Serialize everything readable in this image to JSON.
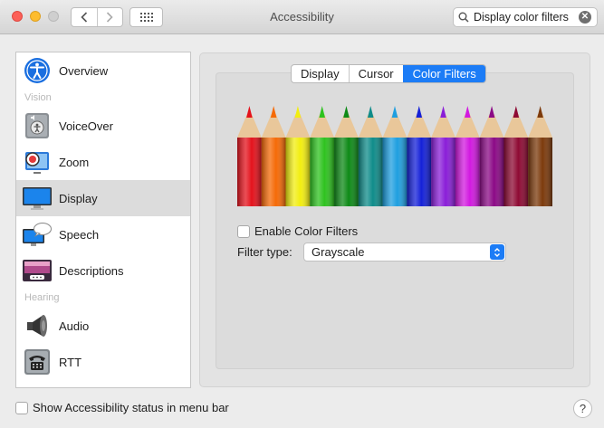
{
  "window": {
    "title": "Accessibility"
  },
  "search": {
    "value": "Display color filters"
  },
  "sidebar": {
    "items": [
      {
        "label": "Overview",
        "icon": "accessibility-icon"
      },
      {
        "label": "VoiceOver",
        "icon": "voiceover-icon"
      },
      {
        "label": "Zoom",
        "icon": "zoom-icon"
      },
      {
        "label": "Display",
        "icon": "display-icon",
        "selected": true
      },
      {
        "label": "Speech",
        "icon": "speech-icon"
      },
      {
        "label": "Descriptions",
        "icon": "descriptions-icon"
      },
      {
        "label": "Audio",
        "icon": "audio-icon"
      },
      {
        "label": "RTT",
        "icon": "rtt-icon"
      }
    ],
    "sections": {
      "vision": "Vision",
      "hearing": "Hearing"
    }
  },
  "tabs": [
    {
      "label": "Display"
    },
    {
      "label": "Cursor"
    },
    {
      "label": "Color Filters",
      "active": true
    }
  ],
  "pencil_colors": [
    "#e4121c",
    "#f56a07",
    "#f2ee10",
    "#2ec21f",
    "#0e8a17",
    "#0f8c8a",
    "#1f9fe0",
    "#1420d8",
    "#8a1ed8",
    "#d219e0",
    "#8b0a86",
    "#8e0a33",
    "#7c3a0c"
  ],
  "color_filters": {
    "enable_label": "Enable Color Filters",
    "enabled": false,
    "filter_type_label": "Filter type:",
    "filter_type_value": "Grayscale"
  },
  "footer": {
    "status_label": "Show Accessibility status in menu bar",
    "status_checked": false,
    "help_label": "?"
  },
  "colors": {
    "accent": "#1c7cf6"
  }
}
